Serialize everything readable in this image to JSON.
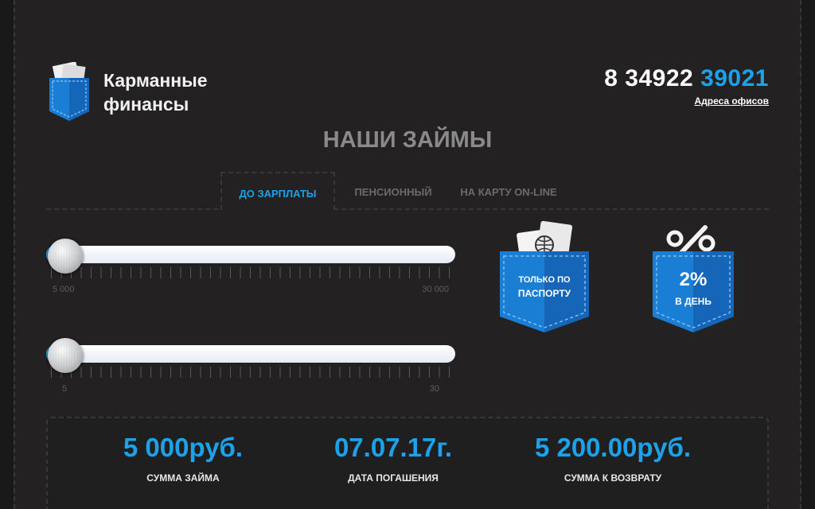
{
  "header": {
    "logo_text": "Карманные финансы",
    "phone_prefix": "8 34922",
    "phone_highlight": "39021",
    "offices_link": "Адреса офисов"
  },
  "section_title": "НАШИ ЗАЙМЫ",
  "tabs": [
    {
      "label": "ДО ЗАРПЛАТЫ",
      "active": true
    },
    {
      "label": "ПЕНСИОННЫЙ",
      "active": false
    },
    {
      "label": "НА КАРТУ ON-LINE",
      "active": false
    }
  ],
  "amount_slider": {
    "min_label": "5 000",
    "max_label": "30 000",
    "value": 5000
  },
  "days_slider": {
    "min_label": "5",
    "max_label": "30",
    "value": 5
  },
  "badges": {
    "passport": {
      "line1": "ТОЛЬКО ПО",
      "line2": "ПАСПОРТУ",
      "icon": "passport-icon"
    },
    "rate": {
      "line1": "2%",
      "line2": "В ДЕНЬ",
      "icon": "percent-icon"
    }
  },
  "results": [
    {
      "value": "5 000руб.",
      "label": "СУММА ЗАЙМА"
    },
    {
      "value": "07.07.17г.",
      "label": "ДАТА ПОГАШЕНИЯ"
    },
    {
      "value": "5 200.00руб.",
      "label": "СУММА К ВОЗВРАТУ"
    }
  ],
  "colors": {
    "accent": "#1ba2eb",
    "background": "#232121",
    "pocket": "#1a7fd4"
  }
}
